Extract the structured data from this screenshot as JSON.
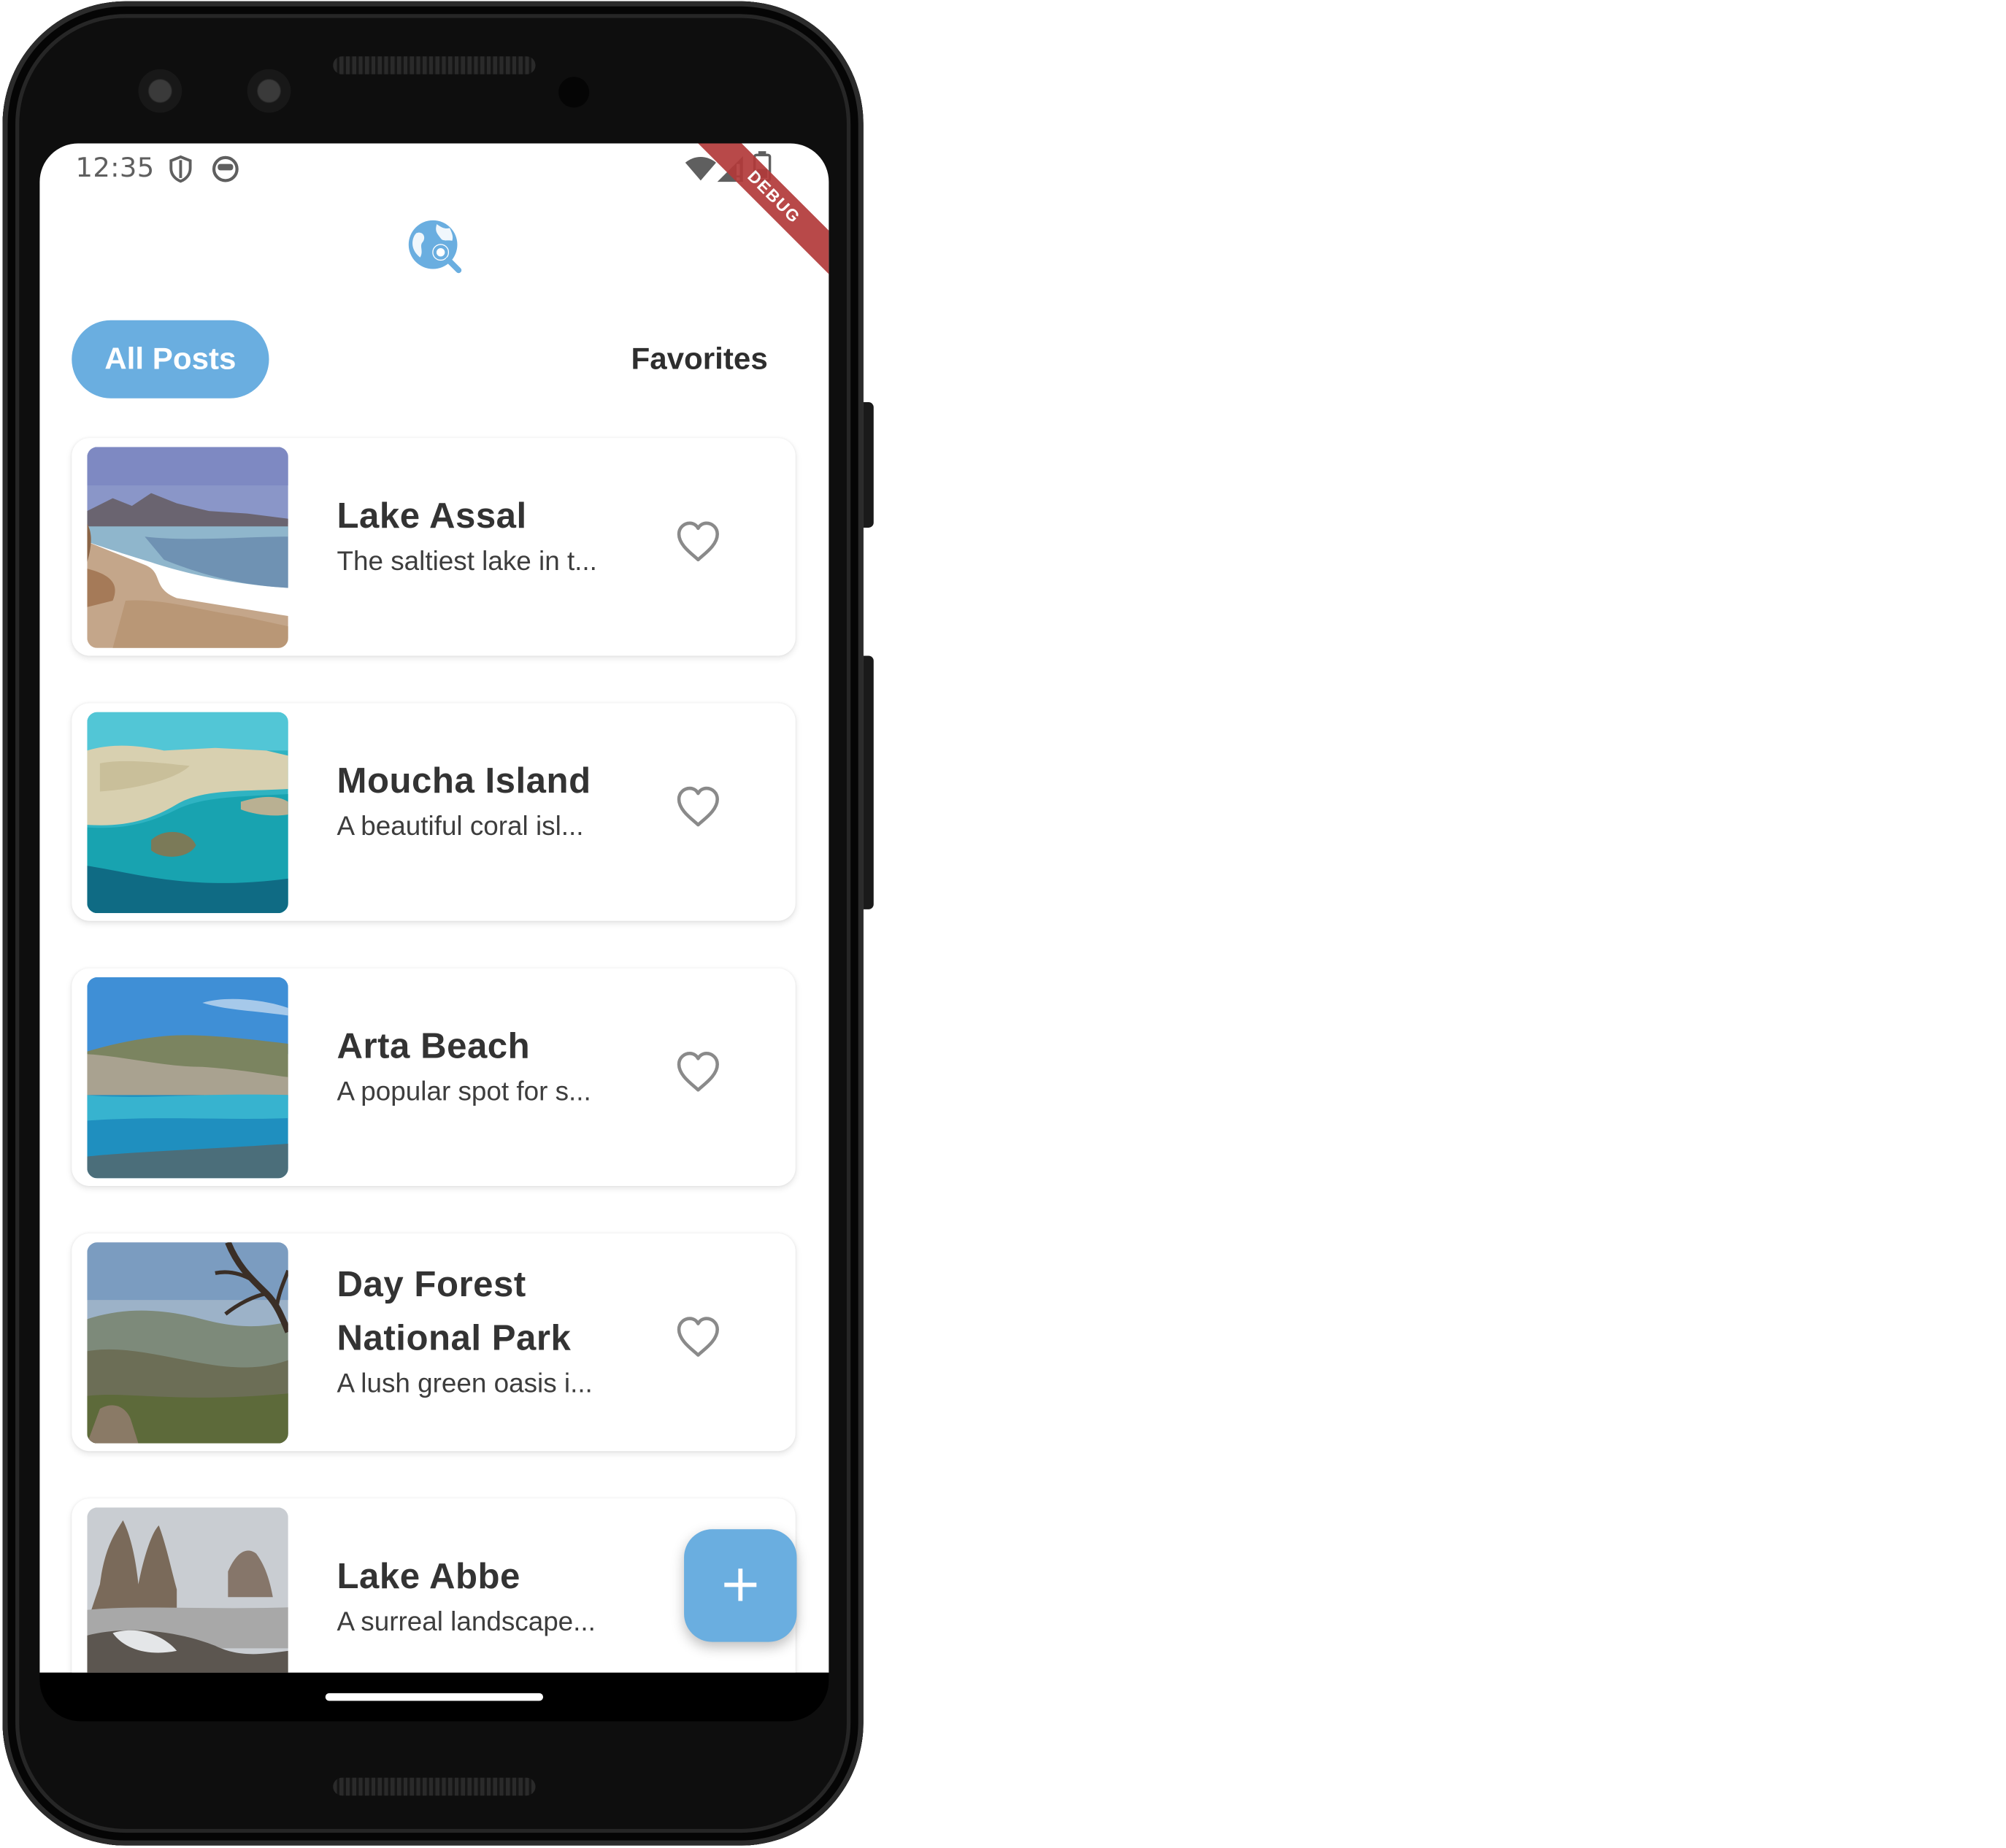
{
  "status_bar": {
    "time": "12:35",
    "debug_banner": "DEBUG",
    "icons": [
      "shield-icon",
      "android-face-icon",
      "wifi-icon",
      "signal-icon",
      "battery-icon"
    ]
  },
  "app_bar": {
    "logo_icon": "globe-search-icon",
    "accent": "#6aaee0"
  },
  "tabs": [
    {
      "label": "All Posts",
      "selected": true
    },
    {
      "label": "Favorites",
      "selected": false
    }
  ],
  "posts": [
    {
      "title": "Lake Assal",
      "description": "The saltiest lake in t...",
      "favorite": false
    },
    {
      "title": "Moucha Island",
      "description": "A beautiful coral isl...",
      "favorite": false
    },
    {
      "title": "Arta Beach",
      "description": "A popular spot for s...",
      "favorite": false
    },
    {
      "title": "Day Forest National Park",
      "description": "A lush green oasis i...",
      "favorite": false
    },
    {
      "title": "Lake Abbe",
      "description": "A surreal landscape...",
      "favorite": false
    }
  ],
  "fab": {
    "label": "+",
    "icon": "plus-icon"
  }
}
